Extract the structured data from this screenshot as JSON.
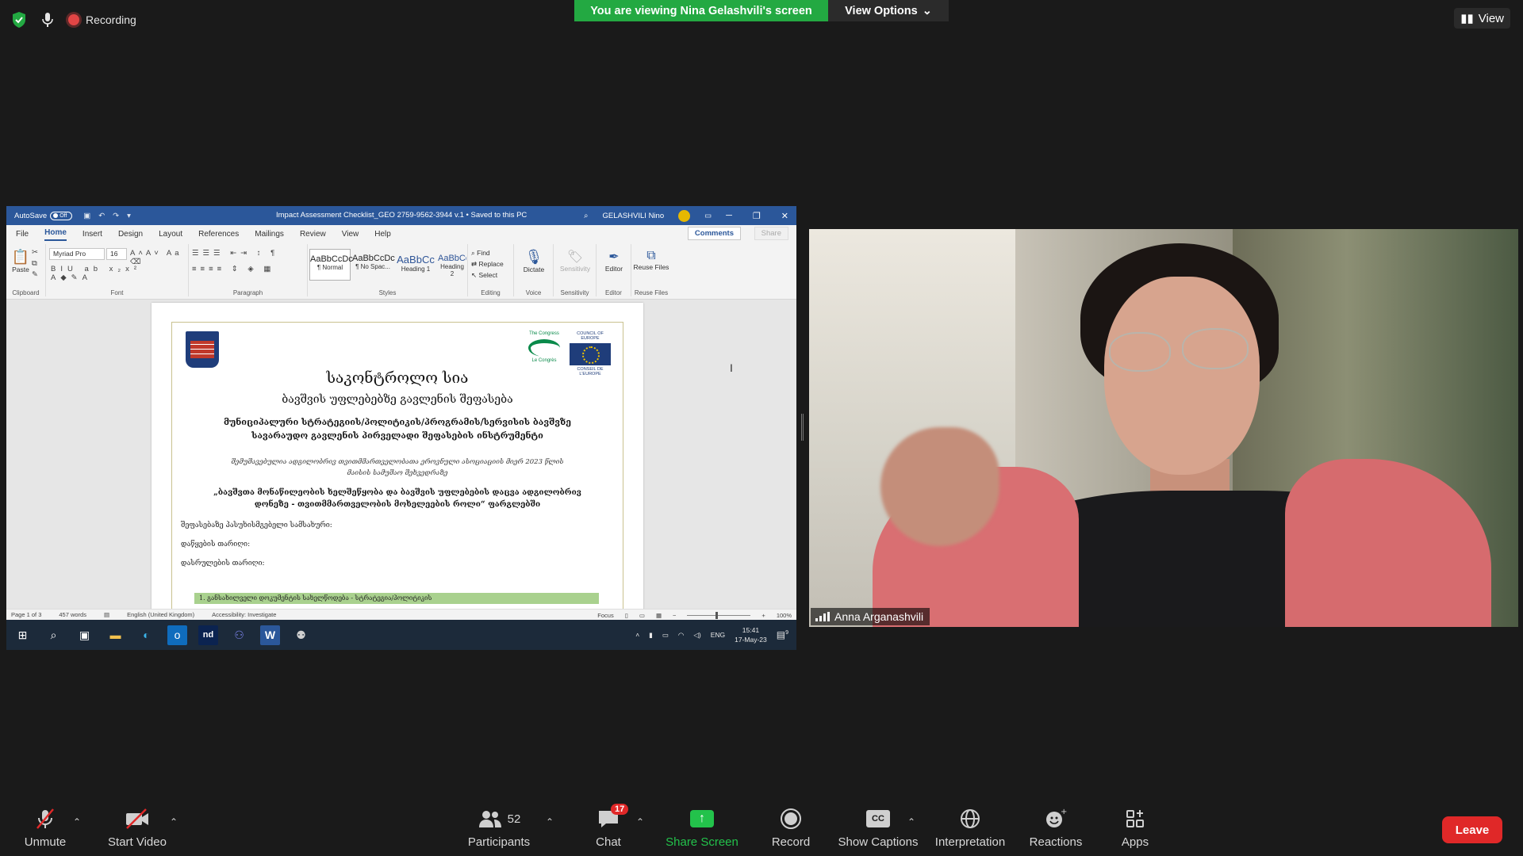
{
  "top": {
    "recording_label": "Recording",
    "viewing_banner": "You are viewing Nina Gelashvili's screen",
    "view_options": "View Options",
    "view_button": "View"
  },
  "word": {
    "autosave_label": "AutoSave",
    "autosave_state": "Off",
    "doc_title": "Impact Assessment Checklist_GEO 2759-9562-3944 v.1 • Saved to this PC",
    "user_name": "GELASHVILI Nino",
    "tabs": [
      "File",
      "Home",
      "Insert",
      "Design",
      "Layout",
      "References",
      "Mailings",
      "Review",
      "View",
      "Help"
    ],
    "comments": "Comments",
    "share": "Share",
    "font_name": "Myriad Pro",
    "font_size": "16",
    "paste": "Paste",
    "groups": {
      "clipboard": "Clipboard",
      "font": "Font",
      "paragraph": "Paragraph",
      "styles": "Styles",
      "editing": "Editing",
      "voice": "Voice",
      "sensitivity": "Sensitivity",
      "editor": "Editor",
      "reuse": "Reuse Files"
    },
    "styles": [
      {
        "preview": "AaBbCcDc",
        "label": "¶ Normal"
      },
      {
        "preview": "AaBbCcDc",
        "label": "¶ No Spac..."
      },
      {
        "preview": "AaBbCc",
        "label": "Heading 1"
      },
      {
        "preview": "AaBbCcE",
        "label": "Heading 2"
      }
    ],
    "find": "Find",
    "replace": "Replace",
    "select": "Select",
    "dictate": "Dictate",
    "sensitivity_btn": "Sensitivity",
    "editor_btn": "Editor",
    "reuse_btn": "Reuse Files",
    "doc": {
      "congress_text": "The Congress",
      "congress_sub": "Le Congrès",
      "coe_text": "COUNCIL OF EUROPE",
      "coe_sub": "CONSEIL DE L'EUROPE",
      "title": "საკონტროლო სია",
      "subtitle": "ბავშვის უფლებებზე გავლენის შეფასება",
      "line3": "მუნიციპალური სტრატეგიის/პოლიტიკის/პროგრამის/სერვისის ბავშვზე სავარაუდო გავლენის პირველადი შეფასების ინსტრუმენტი",
      "line4": "შემუშავებულია ადგილობრივ თვითმმართველობათა ეროვნული ასოციაციის მიერ 2023 წლის მაისის სამუშაო შეხვედრაზე",
      "line5": "„ბავშვთა მონაწილეობის ხელშეწყობა და ბავშვის უფლებების დაცვა ადგილობრივ დონეზე - თვითმმართველობის მოხელეების როლი“ ფარგლებში",
      "field1": "შეფასებაზე პასუხისმგებელი სამსახური:",
      "field2": "დაწყების თარიღი:",
      "field3": "დასრულების თარიღი:",
      "green_row": "1. განსახილველი დოკუმენტის სახელწოდება - სტრატეგია/პოლიტიკის"
    },
    "status": {
      "page": "Page 1 of 3",
      "words": "457 words",
      "language": "English (United Kingdom)",
      "accessibility": "Accessibility: Investigate",
      "focus": "Focus",
      "zoom": "100%"
    },
    "taskbar": {
      "lang": "ENG",
      "time": "15:41",
      "date": "17-May-23",
      "notif": "9"
    }
  },
  "participant": {
    "name": "Anna Arganashvili"
  },
  "toolbar": {
    "unmute": "Unmute",
    "start_video": "Start Video",
    "participants": "Participants",
    "participants_count": "52",
    "chat": "Chat",
    "chat_badge": "17",
    "share_screen": "Share Screen",
    "record": "Record",
    "show_captions": "Show Captions",
    "cc": "CC",
    "interpretation": "Interpretation",
    "reactions": "Reactions",
    "apps": "Apps",
    "leave": "Leave"
  },
  "colors": {
    "zoom_green": "#23a942",
    "leave_red": "#e02828",
    "word_blue": "#2b579a"
  }
}
